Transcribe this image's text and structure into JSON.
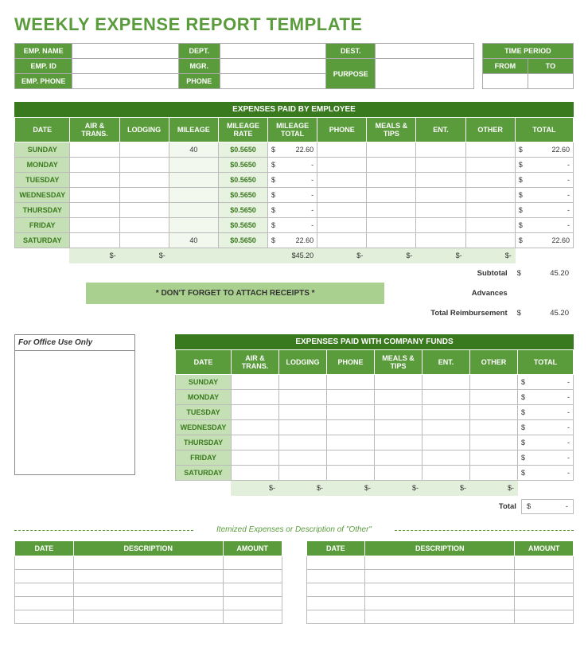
{
  "title": "WEEKLY EXPENSE REPORT TEMPLATE",
  "info": {
    "emp_name": "EMP. NAME",
    "emp_id": "EMP. ID",
    "emp_phone": "EMP. PHONE",
    "dept": "DEPT.",
    "mgr": "MGR.",
    "phone": "PHONE",
    "dest": "DEST.",
    "purpose": "PURPOSE",
    "time_period": "TIME PERIOD",
    "from": "FROM",
    "to": "TO"
  },
  "emp": {
    "title": "EXPENSES PAID BY EMPLOYEE",
    "headers": {
      "date": "DATE",
      "air": "AIR & TRANS.",
      "lodging": "LODGING",
      "mileage": "MILEAGE",
      "rate": "MILEAGE RATE",
      "mtotal": "MILEAGE TOTAL",
      "phone": "PHONE",
      "meals": "MEALS & TIPS",
      "ent": "ENT.",
      "other": "OTHER",
      "total": "TOTAL"
    },
    "rows": [
      {
        "day": "SUNDAY",
        "mileage": "40",
        "rate": "$0.5650",
        "mtotal": "22.60",
        "total": "22.60"
      },
      {
        "day": "MONDAY",
        "mileage": "",
        "rate": "$0.5650",
        "mtotal": "-",
        "total": "-"
      },
      {
        "day": "TUESDAY",
        "mileage": "",
        "rate": "$0.5650",
        "mtotal": "-",
        "total": "-"
      },
      {
        "day": "WEDNESDAY",
        "mileage": "",
        "rate": "$0.5650",
        "mtotal": "-",
        "total": "-"
      },
      {
        "day": "THURSDAY",
        "mileage": "",
        "rate": "$0.5650",
        "mtotal": "-",
        "total": "-"
      },
      {
        "day": "FRIDAY",
        "mileage": "",
        "rate": "$0.5650",
        "mtotal": "-",
        "total": "-"
      },
      {
        "day": "SATURDAY",
        "mileage": "40",
        "rate": "$0.5650",
        "mtotal": "22.60",
        "total": "22.60"
      }
    ],
    "sums": {
      "air": "-",
      "lodging": "-",
      "mtotal": "45.20",
      "phone": "-",
      "meals": "-",
      "ent": "-",
      "other": "-"
    },
    "subtotal_label": "Subtotal",
    "subtotal": "45.20",
    "advances_label": "Advances",
    "reimb_label": "Total Reimbursement",
    "reimb": "45.20",
    "reminder": "* DON'T FORGET TO ATTACH RECEIPTS *"
  },
  "office_label": "For Office Use Only",
  "comp": {
    "title": "EXPENSES PAID WITH COMPANY FUNDS",
    "headers": {
      "date": "DATE",
      "air": "AIR & TRANS.",
      "lodging": "LODGING",
      "phone": "PHONE",
      "meals": "MEALS & TIPS",
      "ent": "ENT.",
      "other": "OTHER",
      "total": "TOTAL"
    },
    "rows": [
      {
        "day": "SUNDAY",
        "total": "-"
      },
      {
        "day": "MONDAY",
        "total": "-"
      },
      {
        "day": "TUESDAY",
        "total": "-"
      },
      {
        "day": "WEDNESDAY",
        "total": "-"
      },
      {
        "day": "THURSDAY",
        "total": "-"
      },
      {
        "day": "FRIDAY",
        "total": "-"
      },
      {
        "day": "SATURDAY",
        "total": "-"
      }
    ],
    "sums": {
      "air": "-",
      "lodging": "-",
      "phone": "-",
      "meals": "-",
      "ent": "-",
      "other": "-"
    },
    "total_label": "Total",
    "total": "-"
  },
  "itemized": {
    "divider": "Itemized Expenses or Description of \"Other\"",
    "headers": {
      "date": "DATE",
      "desc": "DESCRIPTION",
      "amount": "AMOUNT"
    }
  }
}
